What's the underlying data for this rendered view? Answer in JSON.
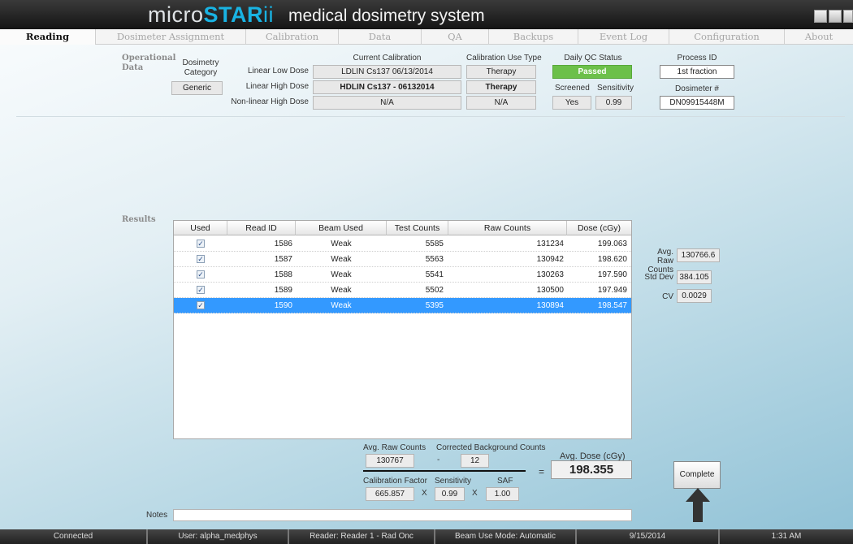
{
  "app": {
    "logo": {
      "micro": "micro",
      "star": "STAR",
      "ii": "ii"
    },
    "title": "medical dosimetry system"
  },
  "tabs": [
    "Reading",
    "Dosimeter Assignment",
    "Calibration",
    "Data",
    "QA",
    "Backups",
    "Event Log",
    "Configuration",
    "About"
  ],
  "operational": {
    "label_line1": "Operational",
    "label_line2": "Data",
    "category_label_1": "Dosimetry",
    "category_label_2": "Category",
    "category_value": "Generic",
    "current_calibration_header": "Current Calibration",
    "use_type_header": "Calibration Use Type",
    "rows": [
      {
        "label": "Linear Low Dose",
        "calibration": "LDLIN Cs137 06/13/2014",
        "use_type": "Therapy"
      },
      {
        "label": "Linear High Dose",
        "calibration": "HDLIN Cs137 - 06132014",
        "use_type": "Therapy"
      },
      {
        "label": "Non-linear High Dose",
        "calibration": "N/A",
        "use_type": "N/A"
      }
    ],
    "qc_header": "Daily QC Status",
    "qc_value": "Passed",
    "screened_label": "Screened",
    "screened_value": "Yes",
    "sensitivity_label": "Sensitivity",
    "sensitivity_value": "0.99",
    "process_id_label": "Process ID",
    "process_id_value": "1st fraction",
    "dosimeter_label": "Dosimeter #",
    "dosimeter_value": "DN09915448M"
  },
  "results": {
    "label": "Results",
    "columns": [
      "Used",
      "Read ID",
      "Beam Used",
      "Test Counts",
      "Raw Counts",
      "Dose (cGy)"
    ],
    "rows": [
      {
        "used": "✓",
        "read_id": "1586",
        "beam": "Weak",
        "test_counts": "5585",
        "raw_counts": "131234",
        "dose": "199.063"
      },
      {
        "used": "✓",
        "read_id": "1587",
        "beam": "Weak",
        "test_counts": "5563",
        "raw_counts": "130942",
        "dose": "198.620"
      },
      {
        "used": "✓",
        "read_id": "1588",
        "beam": "Weak",
        "test_counts": "5541",
        "raw_counts": "130263",
        "dose": "197.590"
      },
      {
        "used": "✓",
        "read_id": "1589",
        "beam": "Weak",
        "test_counts": "5502",
        "raw_counts": "130500",
        "dose": "197.949"
      },
      {
        "used": "✓",
        "read_id": "1590",
        "beam": "Weak",
        "test_counts": "5395",
        "raw_counts": "130894",
        "dose": "198.547"
      }
    ],
    "selected_row": 4
  },
  "stats": {
    "avg_raw_label_1": "Avg. Raw",
    "avg_raw_label_2": "Counts",
    "avg_raw_value": "130766.6",
    "std_dev_label": "Std Dev",
    "std_dev_value": "384.105",
    "cv_label": "CV",
    "cv_value": "0.0029"
  },
  "formula": {
    "avg_raw_counts_label": "Avg. Raw Counts",
    "avg_raw_counts_value": "130767",
    "minus": "-",
    "bg_label": "Corrected Background Counts",
    "bg_value": "12",
    "cal_factor_label": "Calibration Factor",
    "cal_factor_value": "665.857",
    "times": "X",
    "sensitivity_label": "Sensitivity",
    "sensitivity_value": "0.99",
    "saf_label": "SAF",
    "saf_value": "1.00",
    "equals": "=",
    "avg_dose_label": "Avg. Dose (cGy)",
    "avg_dose_value": "198.355"
  },
  "complete_label": "Complete",
  "notes_label": "Notes",
  "notes_value": "",
  "statusbar": [
    "Connected",
    "User: alpha_medphys",
    "Reader: Reader 1 - Rad Onc",
    "Beam Use Mode: Automatic",
    "9/15/2014",
    "1:31 AM"
  ],
  "colors": {
    "accent": "#19b3e3",
    "selected_row": "#3399ff",
    "qc_passed": "#6cc04a"
  }
}
